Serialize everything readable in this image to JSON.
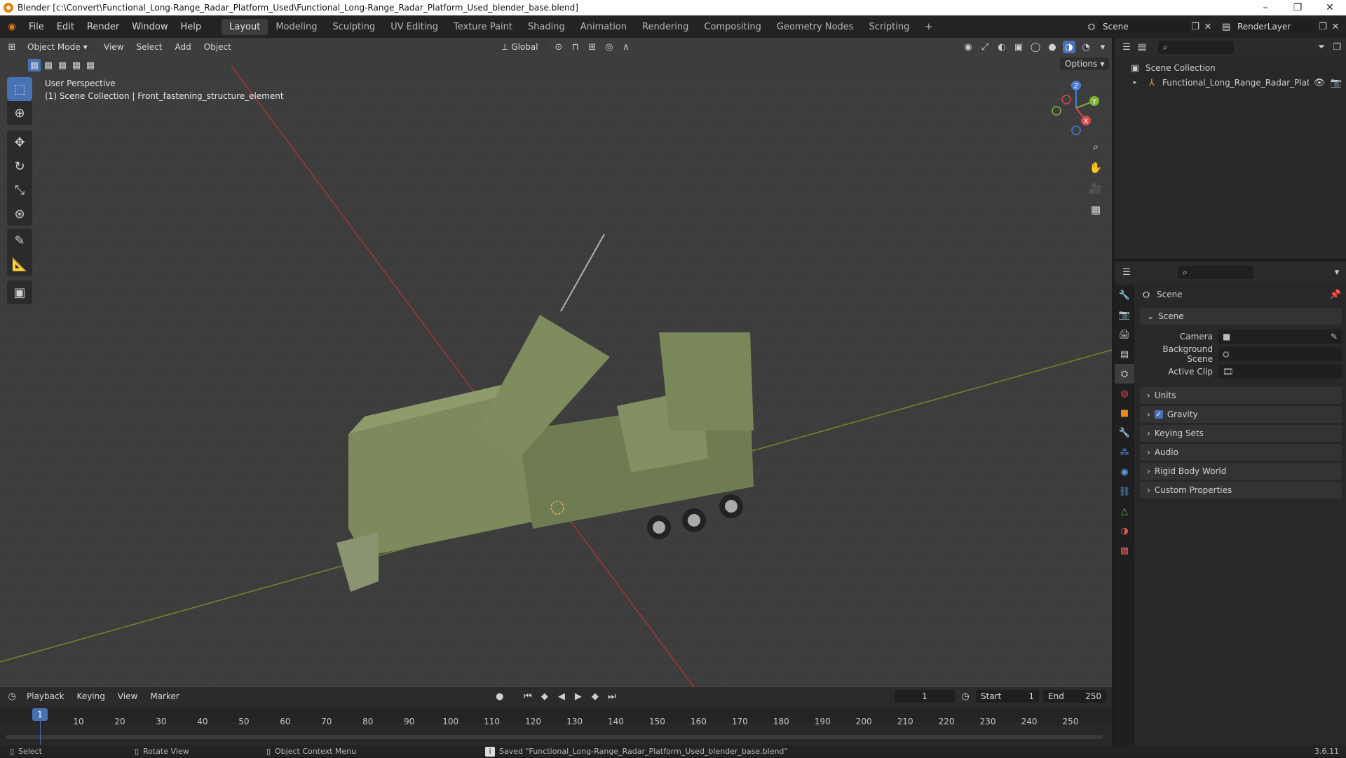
{
  "titlebar": {
    "title": "Blender [c:\\Convert\\Functional_Long-Range_Radar_Platform_Used\\Functional_Long-Range_Radar_Platform_Used_blender_base.blend]",
    "minimize": "–",
    "maximize": "❐",
    "close": "✕"
  },
  "menu": {
    "items": [
      "File",
      "Edit",
      "Render",
      "Window",
      "Help"
    ],
    "workspaces": [
      "Layout",
      "Modeling",
      "Sculpting",
      "UV Editing",
      "Texture Paint",
      "Shading",
      "Animation",
      "Rendering",
      "Compositing",
      "Geometry Nodes",
      "Scripting"
    ],
    "active_workspace": "Layout",
    "add_workspace": "+",
    "scene_name": "Scene",
    "view_layer": "RenderLayer"
  },
  "viewport_header": {
    "mode": "Object Mode",
    "menus": [
      "View",
      "Select",
      "Add",
      "Object"
    ],
    "orientation": "Global",
    "options": "Options"
  },
  "viewport": {
    "info_line1": "User Perspective",
    "info_line2": "(1) Scene Collection | Front_fastening_structure_element",
    "gizmo": {
      "x": "X",
      "y": "Y",
      "z": "Z"
    }
  },
  "outliner": {
    "collection": "Scene Collection",
    "object": "Functional_Long_Range_Radar_Platform"
  },
  "properties": {
    "context": "Scene",
    "section": "Scene",
    "rows": [
      {
        "label": "Camera",
        "value": ""
      },
      {
        "label": "Background Scene",
        "value": ""
      },
      {
        "label": "Active Clip",
        "value": ""
      }
    ],
    "panels": [
      "Units",
      "Gravity",
      "Keying Sets",
      "Audio",
      "Rigid Body World",
      "Custom Properties"
    ],
    "gravity_checked": true
  },
  "timeline": {
    "menus": [
      "Playback",
      "Keying",
      "View",
      "Marker"
    ],
    "current_frame": "1",
    "start_label": "Start",
    "start": "1",
    "end_label": "End",
    "end": "250",
    "ticks": [
      "1",
      "10",
      "20",
      "30",
      "40",
      "50",
      "60",
      "70",
      "80",
      "90",
      "100",
      "110",
      "120",
      "130",
      "140",
      "150",
      "160",
      "170",
      "180",
      "190",
      "200",
      "210",
      "220",
      "230",
      "240",
      "250"
    ]
  },
  "statusbar": {
    "select": "Select",
    "rotate": "Rotate View",
    "context_menu": "Object Context Menu",
    "message": "Saved \"Functional_Long-Range_Radar_Platform_Used_blender_base.blend\"",
    "version": "3.6.11"
  }
}
